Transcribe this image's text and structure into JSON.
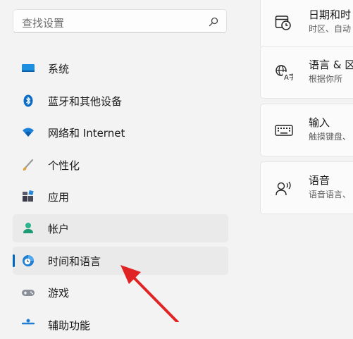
{
  "search": {
    "placeholder": "查找设置",
    "icon": "search-icon"
  },
  "sidebar": {
    "items": [
      {
        "label": "系统",
        "icon": "system-display-icon"
      },
      {
        "label": "蓝牙和其他设备",
        "icon": "bluetooth-icon"
      },
      {
        "label": "网络和 Internet",
        "icon": "wifi-icon"
      },
      {
        "label": "个性化",
        "icon": "brush-icon"
      },
      {
        "label": "应用",
        "icon": "apps-icon"
      },
      {
        "label": "帐户",
        "icon": "account-icon"
      },
      {
        "label": "时间和语言",
        "icon": "time-language-icon"
      },
      {
        "label": "游戏",
        "icon": "gamepad-icon"
      },
      {
        "label": "辅助功能",
        "icon": "accessibility-icon"
      }
    ],
    "active_index": 6
  },
  "cards": [
    {
      "title": "日期和时",
      "subtitle": "时区、自动",
      "icon": "calendar-clock-icon"
    },
    {
      "title": "语言 & 区",
      "subtitle": "根据你所",
      "icon": "language-icon"
    },
    {
      "title": "输入",
      "subtitle": "触摸键盘、",
      "icon": "keyboard-icon"
    },
    {
      "title": "语音",
      "subtitle": "语音语言、",
      "icon": "speech-icon"
    }
  ],
  "colors": {
    "accent": "#0067c0",
    "annotation_arrow": "#e02424",
    "background": "#f3f3f3"
  }
}
